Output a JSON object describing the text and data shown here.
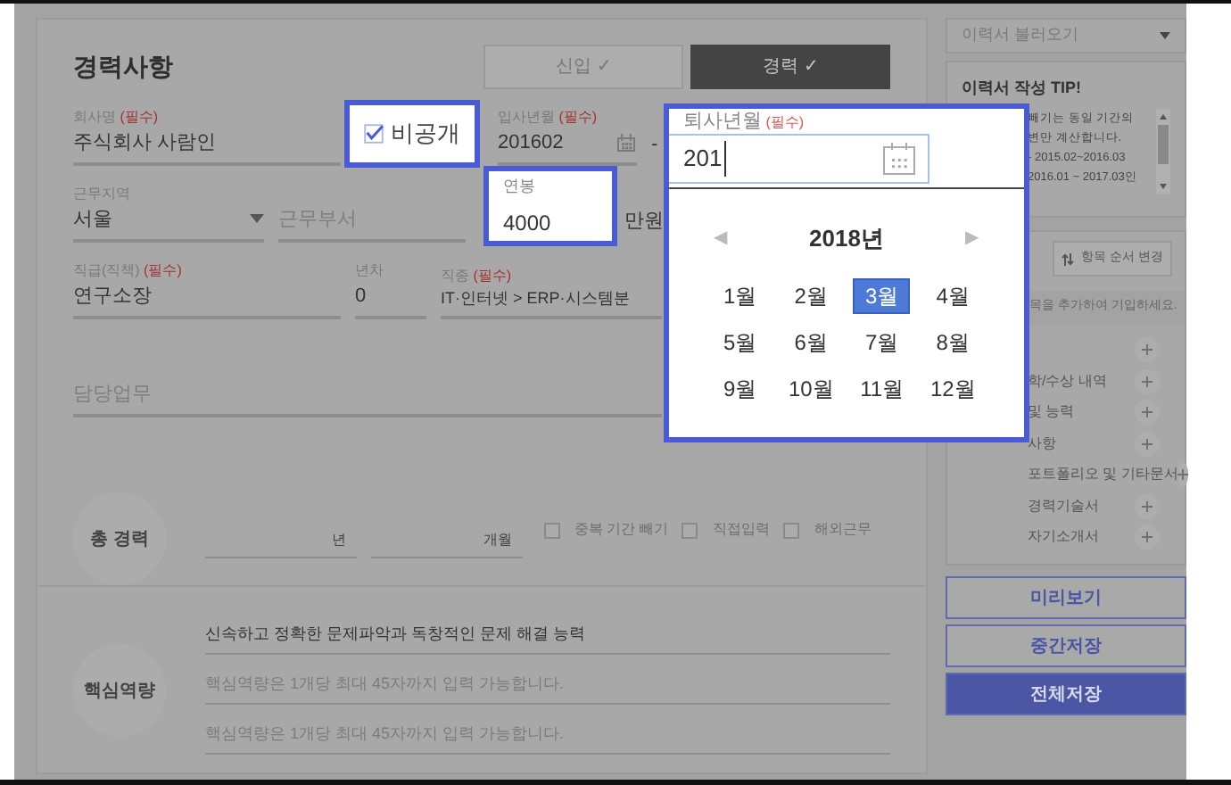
{
  "career": {
    "title": "경력사항",
    "tabs": [
      {
        "label": "신입 ✓",
        "selected": false
      },
      {
        "label": "경력 ✓",
        "selected": true
      }
    ],
    "fields": [
      {
        "kind": "text",
        "label": "회사명",
        "required": "(필수)",
        "value": "주식회사 사람인"
      },
      {
        "kind": "date",
        "label": "입사년월",
        "required": "(필수)",
        "value": "201602",
        "separator": "-"
      },
      {
        "kind": "select",
        "label": "근무지역",
        "value": "서울"
      },
      {
        "kind": "text",
        "placeholder": "근무부서"
      },
      {
        "kind": "unit",
        "value": "만원"
      },
      {
        "kind": "text",
        "label": "직급(직책)",
        "required": "(필수)",
        "value": "연구소장"
      },
      {
        "kind": "text",
        "label": "년차",
        "value": "0"
      },
      {
        "kind": "text",
        "label": "직종",
        "required": "(필수)",
        "value": "IT·인터넷 > ERP·시스템분"
      },
      {
        "kind": "text",
        "placeholder": "담당업무"
      }
    ],
    "total": {
      "label": "총 경력",
      "years_unit": "년",
      "months_unit": "개월",
      "options": [
        {
          "label": "중복 기간 빼기",
          "checked": false
        },
        {
          "label": "직접입력",
          "checked": false
        },
        {
          "label": "해외근무",
          "checked": false
        }
      ]
    },
    "core": {
      "label": "핵심역량",
      "entries": [
        {
          "value": "신속하고 정확한 문제파악과 독창적인 문제 해결 능력"
        },
        {
          "placeholder": "핵심역량은 1개당 최대 45자까지 입력 가능합니다."
        },
        {
          "placeholder": "핵심역량은 1개당 최대 45자까지 입력 가능합니다."
        }
      ]
    }
  },
  "privacy_checkbox": {
    "label": "비공개",
    "checked": true
  },
  "salary_popup": {
    "label": "연봉",
    "value": "4000"
  },
  "date_picker": {
    "label": "퇴사년월",
    "required": "(필수)",
    "value": "201",
    "prev": "◀",
    "year": "2018년",
    "next": "▶",
    "months": [
      {
        "label": "1월",
        "selected": false
      },
      {
        "label": "2월",
        "selected": false
      },
      {
        "label": "3월",
        "selected": true
      },
      {
        "label": "4월",
        "selected": false
      },
      {
        "label": "5월",
        "selected": false
      },
      {
        "label": "6월",
        "selected": false
      },
      {
        "label": "7월",
        "selected": false
      },
      {
        "label": "8월",
        "selected": false
      },
      {
        "label": "9월",
        "selected": false
      },
      {
        "label": "10월",
        "selected": false
      },
      {
        "label": "11월",
        "selected": false
      },
      {
        "label": "12월",
        "selected": false
      }
    ]
  },
  "sidebar": {
    "load_dropdown": "이력서 불러오기",
    "tip": {
      "title": "이력서 작성 TIP!",
      "lines": [
        "빼기는 동일 기간의",
        "변만 계산합니다.",
        "- 2015.02~2016.03",
        "2016.01 ~ 2017.03인"
      ]
    },
    "reorder_button": "항목 순서 변경",
    "hint": "목을 추가하여 기입하세요.",
    "items": [
      {
        "kind": "covered"
      },
      {
        "kind": "entry",
        "label": "학/수상 내역"
      },
      {
        "kind": "entry",
        "label": "및 능력"
      },
      {
        "kind": "entry",
        "label": "사항"
      },
      {
        "kind": "entry",
        "label": "포트폴리오 및 기타문서"
      },
      {
        "kind": "entry",
        "label": "경력기술서"
      },
      {
        "kind": "entry",
        "label": "자기소개서"
      }
    ],
    "buttons": [
      {
        "label": "미리보기",
        "kind": "outline"
      },
      {
        "label": "중간저장",
        "kind": "outline"
      },
      {
        "label": "전체저장",
        "kind": "primary"
      }
    ]
  }
}
